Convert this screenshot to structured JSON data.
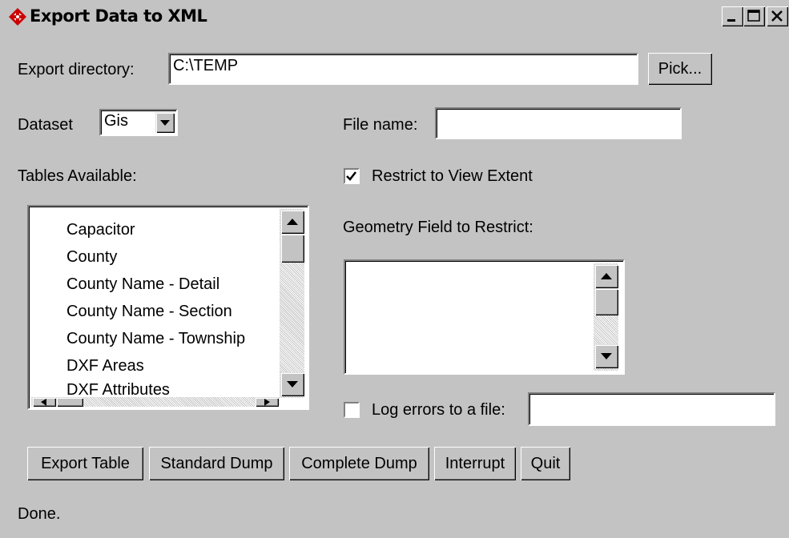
{
  "window": {
    "title": "Export Data to XML",
    "minimize_icon": "minimize-icon",
    "maximize_icon": "maximize-icon",
    "close_icon": "close-icon"
  },
  "export_directory": {
    "label": "Export directory:",
    "value": "C:\\TEMP",
    "pick_label": "Pick..."
  },
  "dataset": {
    "label": "Dataset",
    "selected": "Gis"
  },
  "file_name": {
    "label": "File name:",
    "value": ""
  },
  "tables": {
    "label": "Tables Available:",
    "items": [
      "Capacitor",
      "County",
      "County Name - Detail",
      "County Name - Section",
      "County Name - Township",
      "DXF Areas",
      "DXF Attributes"
    ]
  },
  "restrict": {
    "label": "Restrict to View Extent",
    "checked": true
  },
  "geometry_field": {
    "label": "Geometry Field to Restrict:",
    "items": []
  },
  "log_errors": {
    "label": "Log errors to a file:",
    "checked": false,
    "value": ""
  },
  "buttons": {
    "export_table": "Export Table",
    "standard_dump": "Standard Dump",
    "complete_dump": "Complete Dump",
    "interrupt": "Interrupt",
    "quit": "Quit"
  },
  "status": "Done."
}
